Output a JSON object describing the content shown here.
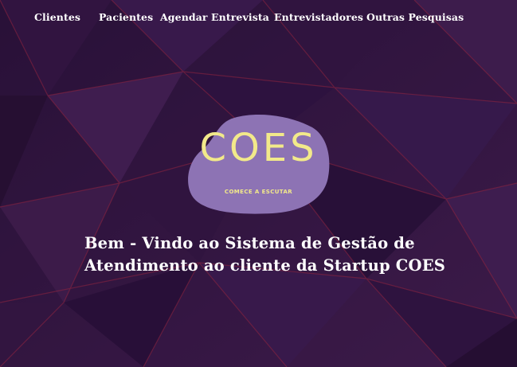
{
  "nav": {
    "items": [
      {
        "label": "Clientes"
      },
      {
        "label": "Pacientes"
      },
      {
        "label": "Agendar Entrevista"
      },
      {
        "label": "Entrevistadores"
      },
      {
        "label": "Outras Pesquisas"
      }
    ]
  },
  "logo": {
    "name": "COES",
    "tagline": "COMECE A ESCUTAR",
    "blob_color": "#8d73b4",
    "text_color": "#f2e98a"
  },
  "hero": {
    "line1": "Bem - Vindo ao Sistema de Gestão de",
    "line2": "Atendimento ao cliente da Startup COES"
  },
  "colors": {
    "background": "#3a1a48",
    "accent_red": "#c0304a",
    "text": "#ffffff"
  }
}
